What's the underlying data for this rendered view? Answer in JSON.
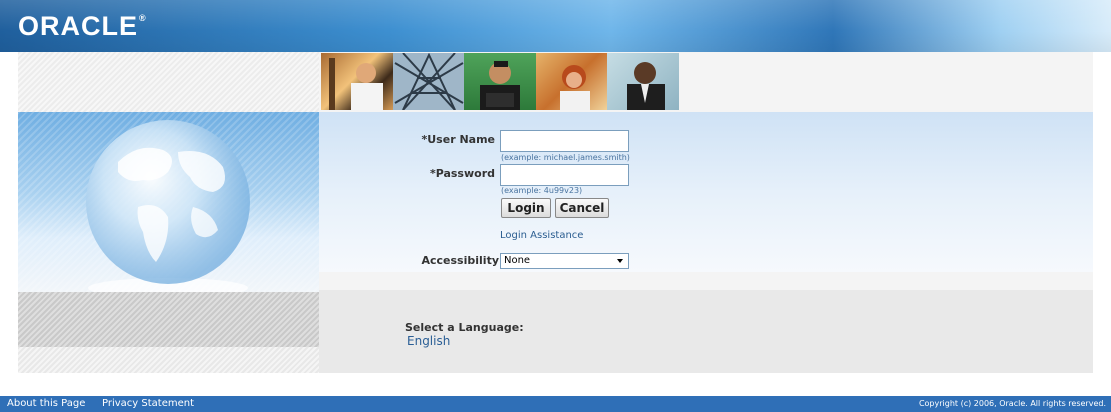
{
  "header": {
    "logo_text": "ORACLE",
    "logo_mark": "®"
  },
  "login": {
    "username_label": "*User Name",
    "username_value": "",
    "username_hint": "(example: michael.james.smith)",
    "password_label": "*Password",
    "password_value": "",
    "password_hint": "(example: 4u99v23)",
    "login_button": "Login",
    "cancel_button": "Cancel",
    "assistance_link": "Login Assistance",
    "accessibility_label": "Accessibility",
    "accessibility_value": "None"
  },
  "language": {
    "label": "Select a Language:",
    "option": "English"
  },
  "footer": {
    "about": "About this Page",
    "privacy": "Privacy Statement",
    "copyright": "Copyright (c) 2006, Oracle. All rights reserved."
  },
  "colors": {
    "header_blue": "#2f76b8",
    "footer_blue": "#2f6fb7",
    "link_blue": "#2b5d91"
  }
}
